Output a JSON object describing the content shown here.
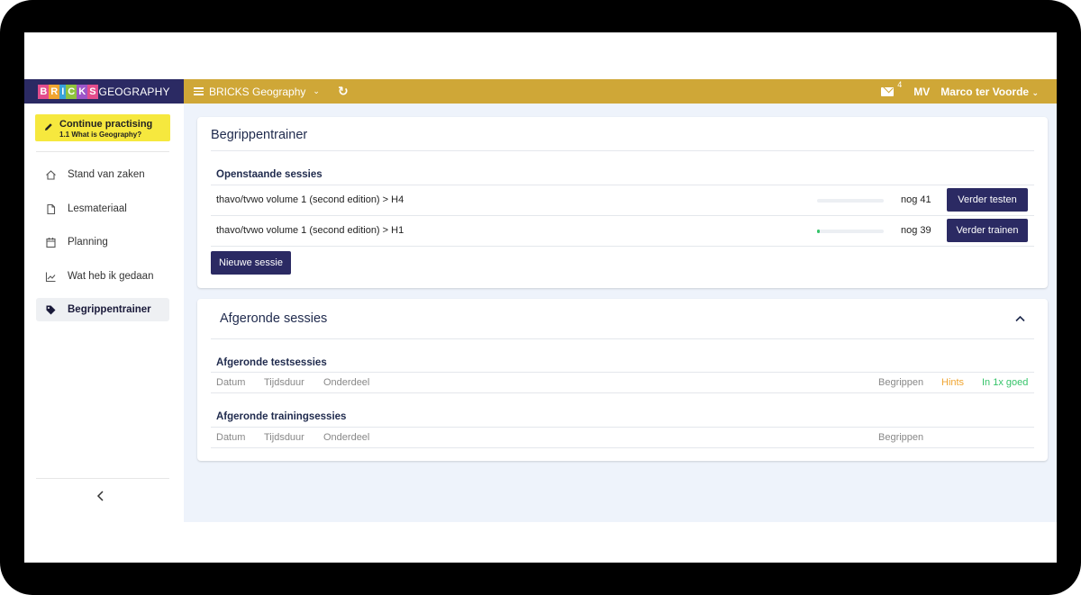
{
  "brand": {
    "logo_letters": [
      "B",
      "R",
      "I",
      "C",
      "K",
      "S"
    ],
    "suffix": "GEOGRAPHY"
  },
  "topbar": {
    "course": "BRICKS Geography",
    "mail_count": "4",
    "initials": "MV",
    "username": "Marco ter Voorde"
  },
  "sidebar": {
    "continue": {
      "title": "Continue practising",
      "subtitle": "1.1 What is Geography?"
    },
    "items": [
      {
        "label": "Stand van zaken",
        "icon": "home-icon"
      },
      {
        "label": "Lesmateriaal",
        "icon": "document-icon"
      },
      {
        "label": "Planning",
        "icon": "calendar-icon"
      },
      {
        "label": "Wat heb ik gedaan",
        "icon": "chart-line-icon"
      },
      {
        "label": "Begrippentrainer",
        "icon": "tag-icon",
        "active": true
      }
    ]
  },
  "trainer": {
    "title": "Begrippentrainer",
    "open_heading": "Openstaande sessies",
    "sessions": [
      {
        "path": "thavo/tvwo volume 1 (second edition) > ",
        "chapter": "H4",
        "remaining": "nog 41",
        "action": "Verder testen",
        "progress": 0
      },
      {
        "path": "thavo/tvwo volume 1 (second edition) > ",
        "chapter": "H1",
        "remaining": "nog 39",
        "action": "Verder trainen",
        "progress": 0.04
      }
    ],
    "new_button": "Nieuwe sessie"
  },
  "finished": {
    "title": "Afgeronde sessies",
    "test_heading": "Afgeronde testsessies",
    "test_columns": [
      "Datum",
      "Tijdsduur",
      "Onderdeel",
      "Begrippen",
      "Hints",
      "In 1x goed"
    ],
    "training_heading": "Afgeronde trainingsessies",
    "training_columns": [
      "Datum",
      "Tijdsduur",
      "Onderdeel",
      "Begrippen"
    ]
  },
  "colors": {
    "navy": "#2b2a63",
    "gold": "#cfa737",
    "yellow": "#f6e83e",
    "green": "#36c46a",
    "orange": "#f0a531"
  }
}
